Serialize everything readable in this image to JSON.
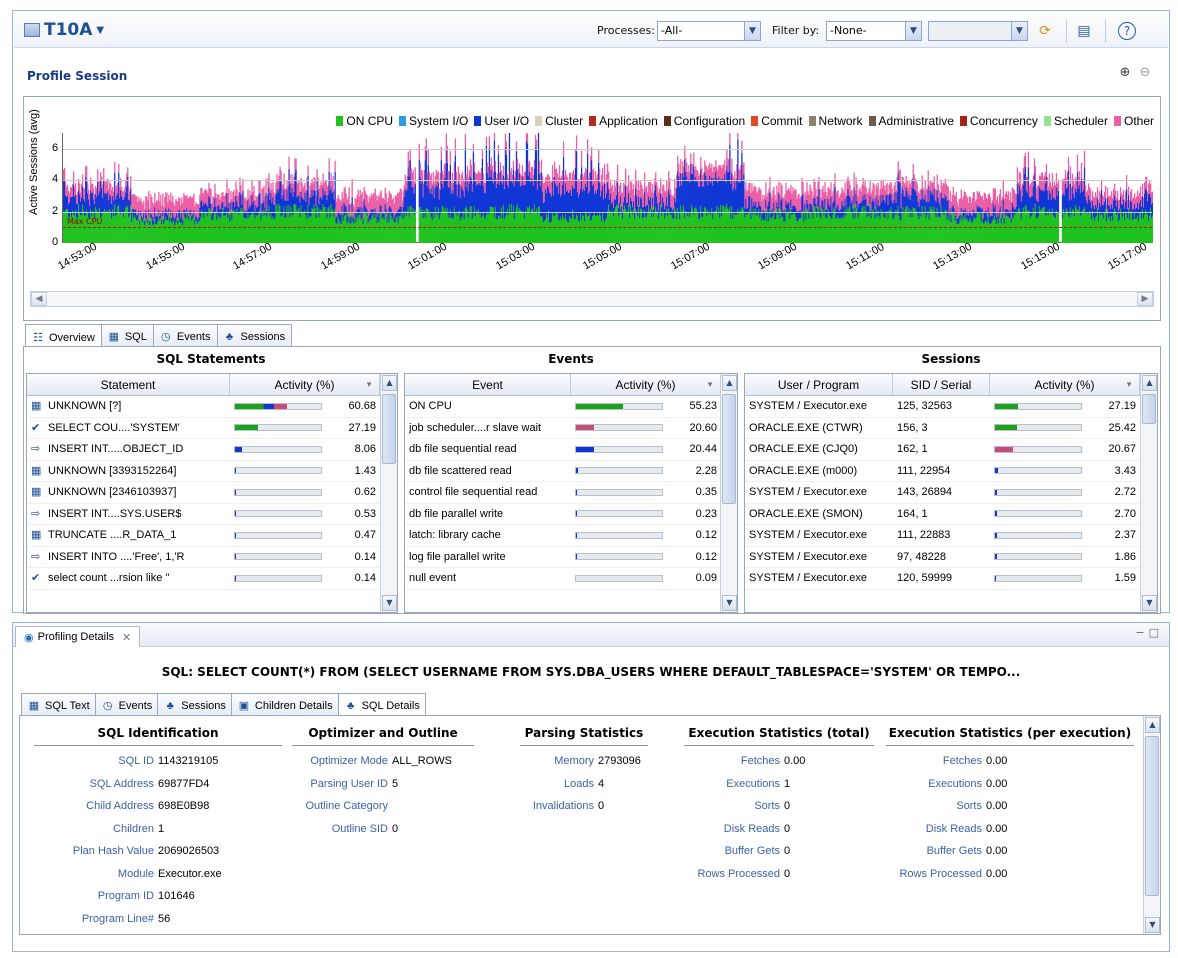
{
  "header": {
    "title": "T10A",
    "processes_label": "Processes:",
    "processes_value": "-All-",
    "filter_label": "Filter by:",
    "filter_value": "-None-",
    "filter_extra_value": ""
  },
  "profile": {
    "title": "Profile Session"
  },
  "chart_data": {
    "type": "area",
    "ylabel": "Active Sessions (avg)",
    "yticks": [
      "0",
      "2",
      "4",
      "6"
    ],
    "ylim": [
      0,
      7
    ],
    "xticks": [
      "14:53:00",
      "14:55:00",
      "14:57:00",
      "14:59:00",
      "15:01:00",
      "15:03:00",
      "15:05:00",
      "15:07:00",
      "15:09:00",
      "15:11:00",
      "15:13:00",
      "15:15:00",
      "15:17:00"
    ],
    "avg_line_label": "Max CPU",
    "avg_line_value": 1,
    "legend": [
      {
        "name": "ON CPU",
        "color": "#1fc21f"
      },
      {
        "name": "System I/O",
        "color": "#2f9be0"
      },
      {
        "name": "User I/O",
        "color": "#1136d6"
      },
      {
        "name": "Cluster",
        "color": "#d8d2b8"
      },
      {
        "name": "Application",
        "color": "#b22a1c"
      },
      {
        "name": "Configuration",
        "color": "#5a2d15"
      },
      {
        "name": "Commit",
        "color": "#e34a24"
      },
      {
        "name": "Network",
        "color": "#8a8171"
      },
      {
        "name": "Administrative",
        "color": "#6b5b4a"
      },
      {
        "name": "Concurrency",
        "color": "#a52416"
      },
      {
        "name": "Scheduler",
        "color": "#94e394"
      },
      {
        "name": "Other",
        "color": "#ec5fa5"
      }
    ],
    "series_approx": [
      {
        "name": "ON CPU",
        "values": [
          2,
          1.5,
          1.8,
          2,
          1.6,
          1.9,
          2,
          1.7,
          2,
          2,
          1.8,
          2,
          1.9,
          1.6,
          2,
          1.8
        ]
      },
      {
        "name": "User I/O",
        "values": [
          1,
          0.3,
          0.5,
          1,
          0.4,
          1.6,
          2,
          1.6,
          0.6,
          2,
          0.5,
          0.6,
          1,
          0.4,
          1.2,
          0.7
        ]
      },
      {
        "name": "Other",
        "values": [
          0.7,
          1,
          0.8,
          0.8,
          1,
          0.9,
          0.7,
          1,
          1,
          0.8,
          1,
          0.9,
          0.8,
          1,
          0.9,
          0.7
        ]
      }
    ]
  },
  "tabs": [
    {
      "label": "Overview"
    },
    {
      "label": "SQL"
    },
    {
      "label": "Events"
    },
    {
      "label": "Sessions"
    }
  ],
  "sql_statements": {
    "title": "SQL Statements",
    "col_statement": "Statement",
    "col_activity": "Activity (%)",
    "rows": [
      {
        "text": "UNKNOWN [?]",
        "value": "60.68",
        "pct": 60.68
      },
      {
        "text": "SELECT COU....'SYSTEM'",
        "value": "27.19",
        "pct": 27.19
      },
      {
        "text": "INSERT INT.....OBJECT_ID",
        "value": "8.06",
        "pct": 8.06
      },
      {
        "text": "UNKNOWN [3393152264]",
        "value": "1.43",
        "pct": 1.43
      },
      {
        "text": "UNKNOWN [2346103937]",
        "value": "0.62",
        "pct": 0.62
      },
      {
        "text": "INSERT INT....SYS.USER$",
        "value": "0.53",
        "pct": 0.53
      },
      {
        "text": "TRUNCATE ....R_DATA_1",
        "value": "0.47",
        "pct": 0.47
      },
      {
        "text": "INSERT INTO ....'Free', 1,'R",
        "value": "0.14",
        "pct": 0.14
      },
      {
        "text": "select count ...rsion like ''",
        "value": "0.14",
        "pct": 0.14
      }
    ]
  },
  "events": {
    "title": "Events",
    "col_event": "Event",
    "col_activity": "Activity (%)",
    "rows": [
      {
        "text": "ON CPU",
        "value": "55.23",
        "pct": 55.23
      },
      {
        "text": "job scheduler....r slave wait",
        "value": "20.60",
        "pct": 20.6
      },
      {
        "text": "db file sequential read",
        "value": "20.44",
        "pct": 20.44
      },
      {
        "text": "db file scattered read",
        "value": "2.28",
        "pct": 2.28
      },
      {
        "text": "control file sequential read",
        "value": "0.35",
        "pct": 0.35
      },
      {
        "text": "db file parallel write",
        "value": "0.23",
        "pct": 0.23
      },
      {
        "text": "latch: library cache",
        "value": "0.12",
        "pct": 0.12
      },
      {
        "text": "log file parallel write",
        "value": "0.12",
        "pct": 0.12
      },
      {
        "text": "null event",
        "value": "0.09",
        "pct": 0.09
      }
    ]
  },
  "sessions": {
    "title": "Sessions",
    "col_user": "User / Program",
    "col_sid": "SID / Serial",
    "col_activity": "Activity (%)",
    "rows": [
      {
        "user": "SYSTEM / Executor.exe",
        "sid": "125, 32563",
        "value": "27.19",
        "pct": 27.19
      },
      {
        "user": "ORACLE.EXE (CTWR)",
        "sid": "156, 3",
        "value": "25.42",
        "pct": 25.42
      },
      {
        "user": "ORACLE.EXE (CJQ0)",
        "sid": "162, 1",
        "value": "20.67",
        "pct": 20.67
      },
      {
        "user": "ORACLE.EXE (m000)",
        "sid": "111, 22954",
        "value": "3.43",
        "pct": 3.43
      },
      {
        "user": "SYSTEM / Executor.exe",
        "sid": "143, 26894",
        "value": "2.72",
        "pct": 2.72
      },
      {
        "user": "ORACLE.EXE (SMON)",
        "sid": "164, 1",
        "value": "2.70",
        "pct": 2.7
      },
      {
        "user": "SYSTEM / Executor.exe",
        "sid": "111, 22883",
        "value": "2.37",
        "pct": 2.37
      },
      {
        "user": "SYSTEM / Executor.exe",
        "sid": "97, 48228",
        "value": "1.86",
        "pct": 1.86
      },
      {
        "user": "SYSTEM / Executor.exe",
        "sid": "120, 59999",
        "value": "1.59",
        "pct": 1.59
      }
    ]
  },
  "profiling_details": {
    "tab_label": "Profiling Details",
    "sql_title": "SQL: SELECT COUNT(*) FROM (SELECT USERNAME FROM SYS.DBA_USERS WHERE DEFAULT_TABLESPACE='SYSTEM' OR TEMPO...",
    "tabs": [
      {
        "label": "SQL Text"
      },
      {
        "label": "Events"
      },
      {
        "label": "Sessions"
      },
      {
        "label": "Children Details"
      },
      {
        "label": "SQL Details"
      }
    ],
    "sections": {
      "identification": {
        "title": "SQL Identification",
        "items": [
          {
            "k": "SQL ID",
            "v": "1143219105"
          },
          {
            "k": "SQL Address",
            "v": "69877FD4"
          },
          {
            "k": "Child Address",
            "v": "698E0B98"
          },
          {
            "k": "Children",
            "v": "1"
          },
          {
            "k": "Plan Hash Value",
            "v": "2069026503"
          },
          {
            "k": "Module",
            "v": "Executor.exe"
          },
          {
            "k": "Program ID",
            "v": "101646"
          },
          {
            "k": "Program Line#",
            "v": "56"
          }
        ]
      },
      "optimizer": {
        "title": "Optimizer and Outline",
        "items": [
          {
            "k": "Optimizer Mode",
            "v": "ALL_ROWS"
          },
          {
            "k": "Parsing User ID",
            "v": "5"
          },
          {
            "k": "Outline Category",
            "v": ""
          },
          {
            "k": "Outline SID",
            "v": "0"
          }
        ]
      },
      "parsing": {
        "title": "Parsing Statistics",
        "items": [
          {
            "k": "Memory",
            "v": "2793096"
          },
          {
            "k": "Loads",
            "v": "4"
          },
          {
            "k": "Invalidations",
            "v": "0"
          }
        ]
      },
      "exec_total": {
        "title": "Execution Statistics (total)",
        "items": [
          {
            "k": "Fetches",
            "v": "0.00"
          },
          {
            "k": "Executions",
            "v": "1"
          },
          {
            "k": "Sorts",
            "v": "0"
          },
          {
            "k": "Disk Reads",
            "v": "0"
          },
          {
            "k": "Buffer Gets",
            "v": "0"
          },
          {
            "k": "Rows Processed",
            "v": "0"
          }
        ]
      },
      "exec_per": {
        "title": "Execution Statistics (per execution)",
        "items": [
          {
            "k": "Fetches",
            "v": "0.00"
          },
          {
            "k": "Executions",
            "v": "0.00"
          },
          {
            "k": "Sorts",
            "v": "0.00"
          },
          {
            "k": "Disk Reads",
            "v": "0.00"
          },
          {
            "k": "Buffer Gets",
            "v": "0.00"
          },
          {
            "k": "Rows Processed",
            "v": "0.00"
          }
        ]
      }
    }
  }
}
